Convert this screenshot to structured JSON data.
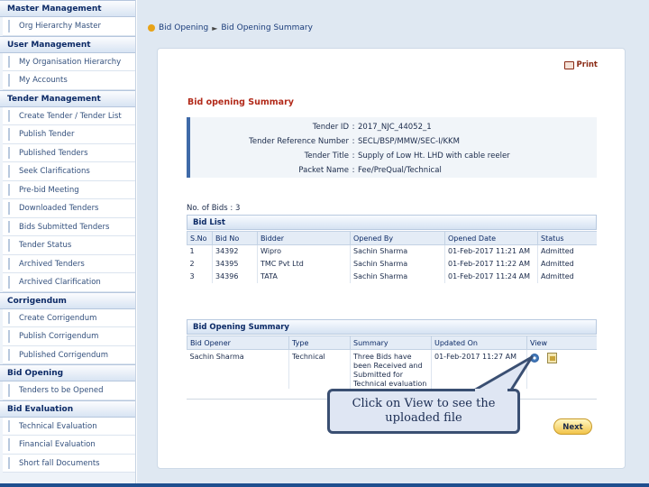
{
  "sidebar": {
    "sections": [
      {
        "title": "Master Management",
        "items": [
          "Org Hierarchy Master"
        ]
      },
      {
        "title": "User Management",
        "items": [
          "My Organisation Hierarchy",
          "My Accounts"
        ]
      },
      {
        "title": "Tender Management",
        "items": [
          "Create Tender / Tender List",
          "Publish Tender",
          "Published Tenders",
          "Seek Clarifications",
          "Pre-bid Meeting",
          "Downloaded Tenders",
          "Bids Submitted Tenders",
          "Tender Status",
          "Archived Tenders",
          "Archived Clarification"
        ]
      },
      {
        "title": "Corrigendum",
        "items": [
          "Create Corrigendum",
          "Publish Corrigendum",
          "Published Corrigendum"
        ]
      },
      {
        "title": "Bid Opening",
        "items": [
          "Tenders to be Opened"
        ]
      },
      {
        "title": "Bid Evaluation",
        "items": [
          "Technical Evaluation",
          "Financial Evaluation",
          "Short fall Documents"
        ]
      }
    ]
  },
  "breadcrumb": {
    "first": "Bid Opening",
    "second": "Bid Opening Summary"
  },
  "print_label": "Print",
  "page_title": "Bid opening Summary",
  "info": [
    {
      "label": "Tender ID",
      "value": "2017_NJC_44052_1"
    },
    {
      "label": "Tender Reference Number",
      "value": "SECL/BSP/MMW/SEC-I/KKM"
    },
    {
      "label": "Tender Title",
      "value": "Supply of Low Ht. LHD with cable reeler"
    },
    {
      "label": "Packet Name",
      "value": "Fee/PreQual/Technical"
    }
  ],
  "num_bids_label": "No. of Bids : 3",
  "bid_list": {
    "title": "Bid List",
    "columns": [
      "S.No",
      "Bid No",
      "Bidder",
      "Opened By",
      "Opened Date",
      "Status"
    ],
    "rows": [
      [
        "1",
        "34392",
        "Wipro",
        "Sachin Sharma",
        "01-Feb-2017 11:21 AM",
        "Admitted"
      ],
      [
        "2",
        "34395",
        "TMC Pvt Ltd",
        "Sachin Sharma",
        "01-Feb-2017 11:22 AM",
        "Admitted"
      ],
      [
        "3",
        "34396",
        "TATA",
        "Sachin Sharma",
        "01-Feb-2017 11:24 AM",
        "Admitted"
      ]
    ]
  },
  "opening_summary": {
    "title": "Bid Opening Summary",
    "columns": [
      "Bid Opener",
      "Type",
      "Summary",
      "Updated On",
      "View"
    ],
    "row": [
      "Sachin Sharma",
      "Technical",
      "Three Bids have been Received and Submitted for Technical evaluation",
      "01-Feb-2017 11:27 AM"
    ]
  },
  "next_label": "Next",
  "callout": {
    "line1": "Click on View to see the",
    "line2": "uploaded file"
  },
  "colors": {
    "accent": "#3f6aa8",
    "title_red": "#b22a1a",
    "callout_border": "#3a4f72"
  }
}
